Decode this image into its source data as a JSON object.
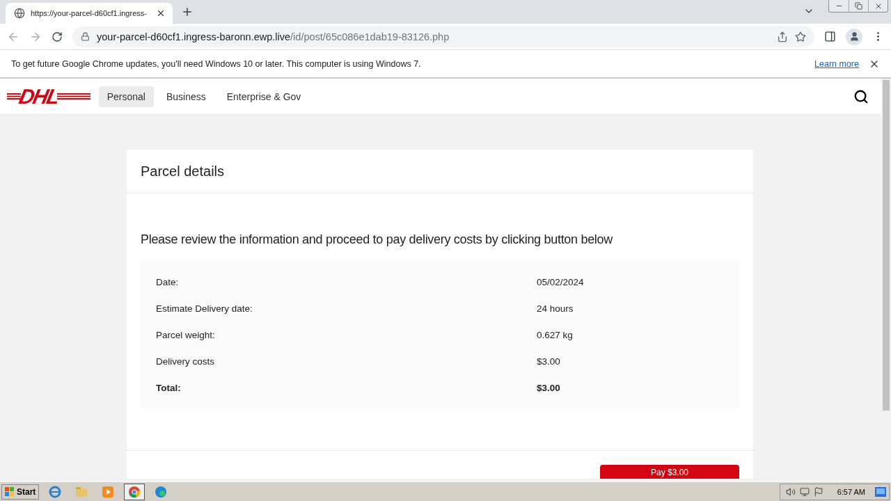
{
  "browser": {
    "tab": {
      "title": "https://your-parcel-d60cf1.ingress-"
    },
    "address": {
      "host": "your-parcel-d60cf1.ingress-baronn.ewp.live",
      "path": "/id/post/65c086e1dab19-83126.php"
    },
    "infobar": {
      "message": "To get future Google Chrome updates, you'll need Windows 10 or later. This computer is using Windows 7.",
      "link": "Learn more"
    }
  },
  "site": {
    "logo": "DHL",
    "nav": [
      {
        "label": "Personal",
        "selected": true
      },
      {
        "label": "Business",
        "selected": false
      },
      {
        "label": "Enterprise & Gov",
        "selected": false
      }
    ]
  },
  "card": {
    "title": "Parcel details",
    "intro": "Please review the information and proceed to pay delivery costs by clicking button below",
    "rows": [
      {
        "label": "Date:",
        "value": "05/02/2024",
        "bold": false
      },
      {
        "label": "Estimate Delivery date:",
        "value": "24 hours",
        "bold": false
      },
      {
        "label": "Parcel weight:",
        "value": "0.627 kg",
        "bold": false
      },
      {
        "label": "Delivery costs",
        "value": "$3.00",
        "bold": false
      },
      {
        "label": "Total:",
        "value": "$3.00",
        "bold": true
      }
    ],
    "button": "Pay $3.00"
  },
  "taskbar": {
    "start": "Start",
    "clock": "6:57 AM"
  }
}
